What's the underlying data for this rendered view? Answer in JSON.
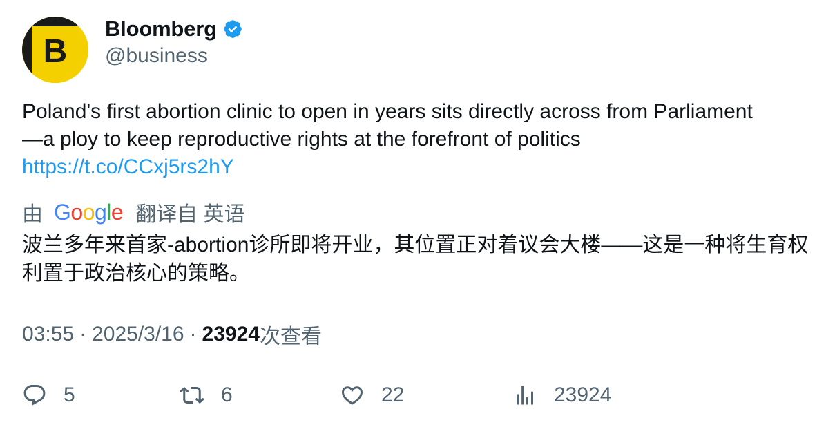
{
  "author": {
    "display_name": "Bloomberg",
    "handle": "@business",
    "avatar_letter": "B",
    "verified": true,
    "avatar_color": "#f5d000"
  },
  "tweet": {
    "text": "Poland's first abortion clinic to open in years sits directly across from Parliament\n—a ploy to keep reproductive rights at the forefront of politics",
    "link": "https://t.co/CCxj5rs2hY"
  },
  "translation": {
    "prefix": "由",
    "provider": "Google",
    "suffix": "翻译自 英语",
    "text": "波兰多年来首家-abortion诊所即将开业，其位置正对着议会大楼——这是一种将生育权利置于政治核心的策略。"
  },
  "meta": {
    "time": "03:55",
    "separator": "·",
    "date": "2025/3/16",
    "views_count": "23924",
    "views_label": "次查看"
  },
  "actions": {
    "replies": "5",
    "retweets": "6",
    "likes": "22",
    "views": "23924"
  },
  "icons": {
    "verified": "verified-badge-icon",
    "reply": "reply-bubble-icon",
    "retweet": "retweet-arrows-icon",
    "like": "heart-icon",
    "views": "bar-chart-icon"
  },
  "colors": {
    "accent_blue": "#1d9bf0",
    "text_primary": "#0f1419",
    "text_secondary": "#536471"
  }
}
